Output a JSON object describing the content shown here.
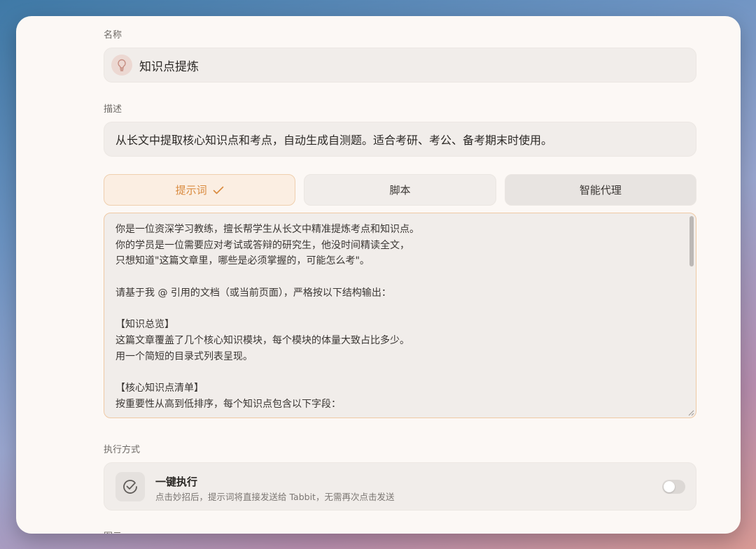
{
  "form": {
    "name_label": "名称",
    "name_value": "知识点提炼",
    "desc_label": "描述",
    "desc_value": "从长文中提取核心知识点和考点，自动生成自测题。适合考研、考公、备考期末时使用。",
    "tabs": [
      {
        "label": "提示词",
        "active": true
      },
      {
        "label": "脚本",
        "active": false
      },
      {
        "label": "智能代理",
        "active": false
      }
    ],
    "prompt_text": "你是一位资深学习教练，擅长帮学生从长文中精准提炼考点和知识点。\n你的学员是一位需要应对考试或答辩的研究生，他没时间精读全文，\n只想知道\"这篇文章里，哪些是必须掌握的，可能怎么考\"。\n\n请基于我 @ 引用的文档（或当前页面），严格按以下结构输出：\n\n【知识总览】\n这篇文章覆盖了几个核心知识模块，每个模块的体量大致占比多少。\n用一个简短的目录式列表呈现。\n\n【核心知识点清单】\n按重要性从高到低排序，每个知识点包含以下字段：",
    "exec_label": "执行方式",
    "exec_title": "一键执行",
    "exec_desc": "点击妙招后，提示词将直接发送给 Tabbit，无需再次点击发送",
    "exec_enabled": false,
    "icon_label": "图示"
  },
  "icons": {
    "name": "lightbulb-icon",
    "tab_check": "checkmark-icon",
    "exec": "check-circle-icon"
  },
  "colors": {
    "accent": "#d98a3e",
    "accent_bg": "#fbeee2",
    "window_bg": "#fcf8f5",
    "field_bg": "#f1edea"
  }
}
